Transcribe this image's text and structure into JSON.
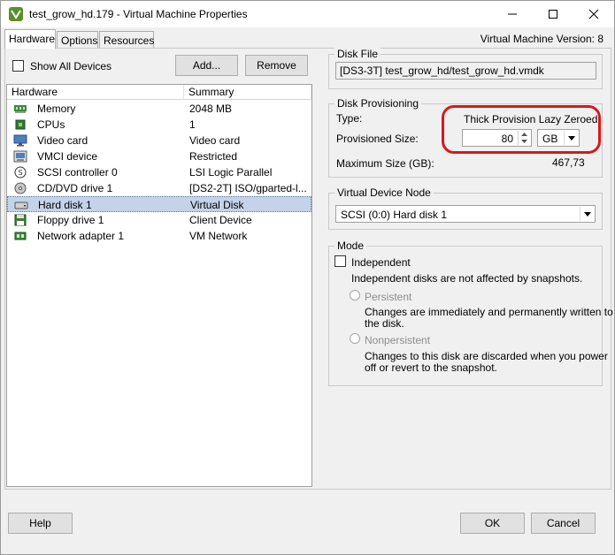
{
  "window": {
    "title": "test_grow_hd.179 - Virtual Machine Properties",
    "version": "Virtual Machine Version: 8"
  },
  "tabs": [
    {
      "label": "Hardware"
    },
    {
      "label": "Options"
    },
    {
      "label": "Resources"
    }
  ],
  "devices": {
    "show_all_label": "Show All Devices",
    "add_label": "Add...",
    "remove_label": "Remove",
    "columns": [
      "Hardware",
      "Summary"
    ],
    "rows": [
      {
        "name": "Memory",
        "summary": "2048 MB",
        "icon": "memory-icon"
      },
      {
        "name": "CPUs",
        "summary": "1",
        "icon": "cpu-icon"
      },
      {
        "name": "Video card",
        "summary": "Video card",
        "icon": "monitor-icon"
      },
      {
        "name": "VMCI device",
        "summary": "Restricted",
        "icon": "vmci-icon"
      },
      {
        "name": "SCSI controller 0",
        "summary": "LSI Logic Parallel",
        "icon": "scsi-icon"
      },
      {
        "name": "CD/DVD drive 1",
        "summary": "[DS2-2T] ISO/gparted-l...",
        "icon": "cd-icon"
      },
      {
        "name": "Hard disk 1",
        "summary": "Virtual Disk",
        "icon": "harddisk-icon"
      },
      {
        "name": "Floppy drive 1",
        "summary": "Client Device",
        "icon": "floppy-icon"
      },
      {
        "name": "Network adapter 1",
        "summary": "VM Network",
        "icon": "network-icon"
      }
    ],
    "selected_index": 6
  },
  "disk_file": {
    "title": "Disk File",
    "value": "[DS3-3T] test_grow_hd/test_grow_hd.vmdk"
  },
  "provisioning": {
    "title": "Disk Provisioning",
    "type_label": "Type:",
    "type_value": "Thick Provision Lazy Zeroed",
    "size_label": "Provisioned Size:",
    "size_value": "80",
    "unit_value": "GB",
    "max_label": "Maximum Size (GB):",
    "max_value": "467,73"
  },
  "vdn": {
    "title": "Virtual Device Node",
    "value": "SCSI (0:0) Hard disk 1"
  },
  "mode": {
    "title": "Mode",
    "independent_label": "Independent",
    "independent_desc": "Independent disks are not affected by snapshots.",
    "persistent_label": "Persistent",
    "persistent_desc_1": "Changes are immediately and permanently written to",
    "persistent_desc_2": "the disk.",
    "nonpersistent_label": "Nonpersistent",
    "nonpersistent_desc_1": "Changes to this disk are discarded when you power",
    "nonpersistent_desc_2": "off or revert to the snapshot."
  },
  "footer": {
    "help_label": "Help",
    "ok_label": "OK",
    "cancel_label": "Cancel"
  },
  "colors": {
    "selection": "#c4d3e8",
    "highlight": "#d41a1a"
  }
}
